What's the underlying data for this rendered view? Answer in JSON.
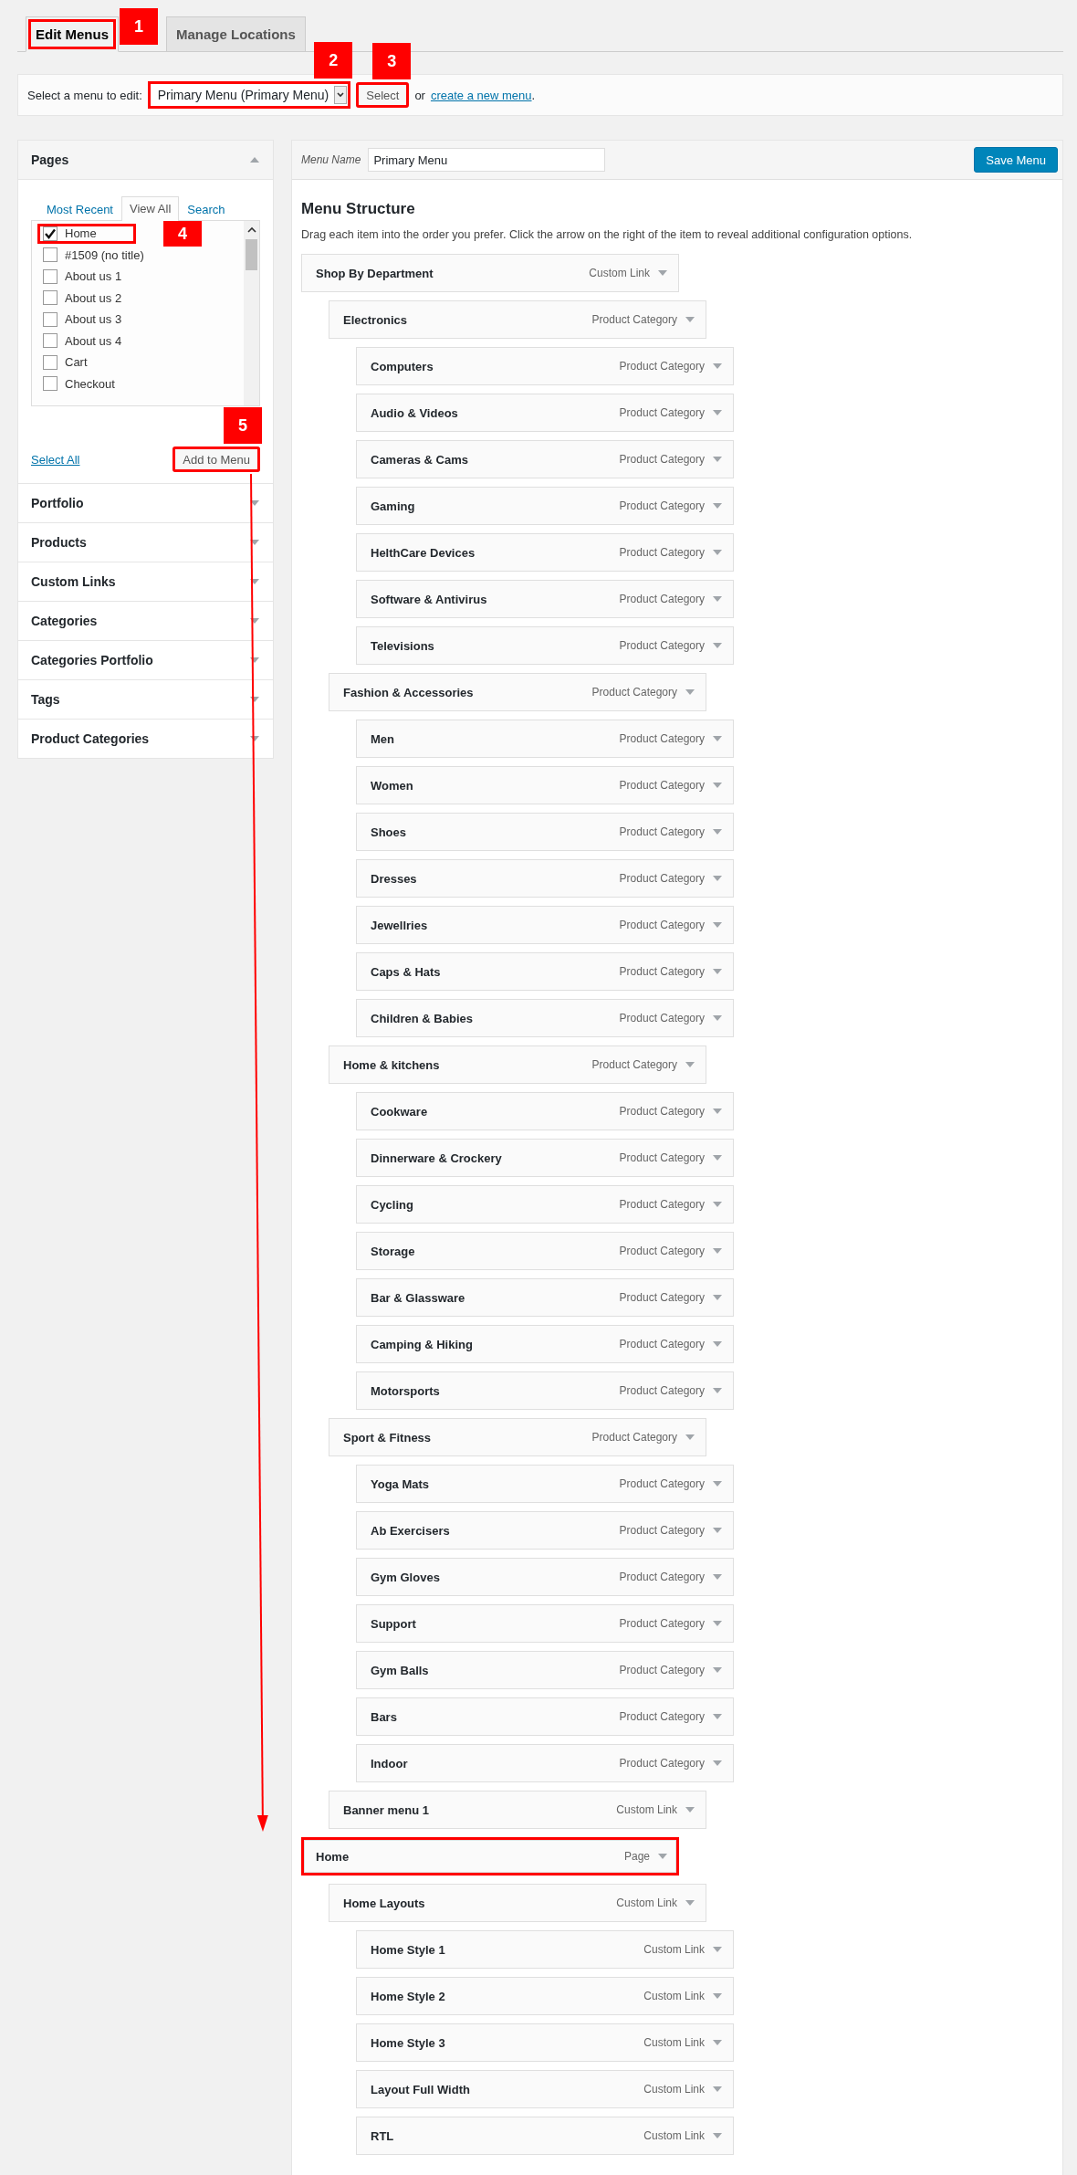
{
  "tabs": [
    {
      "label": "Edit Menus",
      "selected": true,
      "highlighted": true,
      "callout": "1"
    },
    {
      "label": "Manage Locations",
      "selected": false,
      "highlighted": false
    }
  ],
  "menu_select": {
    "label": "Select a menu to edit:",
    "value": "Primary Menu (Primary Menu)",
    "highlighted": true,
    "callout": "2",
    "button": {
      "label": "Select",
      "highlighted": true,
      "callout": "3"
    },
    "or_text": "or",
    "create_link": "create a new menu",
    "period": "."
  },
  "sidebar": {
    "pages": {
      "title": "Pages",
      "expanded": true,
      "tabs": [
        {
          "label": "Most Recent",
          "selected": false
        },
        {
          "label": "View All",
          "selected": true
        },
        {
          "label": "Search",
          "selected": false
        }
      ],
      "items": [
        {
          "label": "Home",
          "checked": true,
          "highlighted": true,
          "callout": "4"
        },
        {
          "label": "#1509 (no title)",
          "checked": false,
          "highlighted": false
        },
        {
          "label": "About us 1",
          "checked": false,
          "highlighted": false
        },
        {
          "label": "About us 2",
          "checked": false,
          "highlighted": false
        },
        {
          "label": "About us 3",
          "checked": false,
          "highlighted": false
        },
        {
          "label": "About us 4",
          "checked": false,
          "highlighted": false
        },
        {
          "label": "Cart",
          "checked": false,
          "highlighted": false
        },
        {
          "label": "Checkout",
          "checked": false,
          "highlighted": false
        }
      ],
      "select_all": "Select All",
      "add_button": {
        "label": "Add to Menu",
        "highlighted": true,
        "callout": "5"
      }
    },
    "sections": [
      {
        "title": "Portfolio",
        "expanded": false
      },
      {
        "title": "Products",
        "expanded": false
      },
      {
        "title": "Custom Links",
        "expanded": false
      },
      {
        "title": "Categories",
        "expanded": false
      },
      {
        "title": "Categories Portfolio",
        "expanded": false
      },
      {
        "title": "Tags",
        "expanded": false
      },
      {
        "title": "Product Categories",
        "expanded": false
      }
    ]
  },
  "editor": {
    "name_label": "Menu Name",
    "name_value": "Primary Menu",
    "save_button": "Save Menu",
    "heading": "Menu Structure",
    "description": "Drag each item into the order you prefer. Click the arrow on the right of the item to reveal additional configuration options.",
    "items": [
      {
        "title": "Shop By Department",
        "type": "Custom Link",
        "highlighted": false,
        "children": [
          {
            "title": "Electronics",
            "type": "Product Category",
            "highlighted": false,
            "children": [
              {
                "title": "Computers",
                "type": "Product Category",
                "highlighted": false
              },
              {
                "title": "Audio & Videos",
                "type": "Product Category",
                "highlighted": false
              },
              {
                "title": "Cameras & Cams",
                "type": "Product Category",
                "highlighted": false
              },
              {
                "title": "Gaming",
                "type": "Product Category",
                "highlighted": false
              },
              {
                "title": "HelthCare Devices",
                "type": "Product Category",
                "highlighted": false
              },
              {
                "title": "Software & Antivirus",
                "type": "Product Category",
                "highlighted": false
              },
              {
                "title": "Televisions",
                "type": "Product Category",
                "highlighted": false
              }
            ]
          },
          {
            "title": "Fashion & Accessories",
            "type": "Product Category",
            "highlighted": false,
            "children": [
              {
                "title": "Men",
                "type": "Product Category",
                "highlighted": false
              },
              {
                "title": "Women",
                "type": "Product Category",
                "highlighted": false
              },
              {
                "title": "Shoes",
                "type": "Product Category",
                "highlighted": false
              },
              {
                "title": "Dresses",
                "type": "Product Category",
                "highlighted": false
              },
              {
                "title": "Jewellries",
                "type": "Product Category",
                "highlighted": false
              },
              {
                "title": "Caps & Hats",
                "type": "Product Category",
                "highlighted": false
              },
              {
                "title": "Children & Babies",
                "type": "Product Category",
                "highlighted": false
              }
            ]
          },
          {
            "title": "Home & kitchens",
            "type": "Product Category",
            "highlighted": false,
            "children": [
              {
                "title": "Cookware",
                "type": "Product Category",
                "highlighted": false
              },
              {
                "title": "Dinnerware & Crockery",
                "type": "Product Category",
                "highlighted": false
              },
              {
                "title": "Cycling",
                "type": "Product Category",
                "highlighted": false
              },
              {
                "title": "Storage",
                "type": "Product Category",
                "highlighted": false
              },
              {
                "title": "Bar & Glassware",
                "type": "Product Category",
                "highlighted": false
              },
              {
                "title": "Camping & Hiking",
                "type": "Product Category",
                "highlighted": false
              },
              {
                "title": "Motorsports",
                "type": "Product Category",
                "highlighted": false
              }
            ]
          },
          {
            "title": "Sport & Fitness",
            "type": "Product Category",
            "highlighted": false,
            "children": [
              {
                "title": "Yoga Mats",
                "type": "Product Category",
                "highlighted": false
              },
              {
                "title": "Ab Exercisers",
                "type": "Product Category",
                "highlighted": false
              },
              {
                "title": "Gym Gloves",
                "type": "Product Category",
                "highlighted": false
              },
              {
                "title": "Support",
                "type": "Product Category",
                "highlighted": false
              },
              {
                "title": "Gym Balls",
                "type": "Product Category",
                "highlighted": false
              },
              {
                "title": "Bars",
                "type": "Product Category",
                "highlighted": false
              },
              {
                "title": "Indoor",
                "type": "Product Category",
                "highlighted": false
              }
            ]
          },
          {
            "title": "Banner menu 1",
            "type": "Custom Link",
            "highlighted": false
          }
        ]
      },
      {
        "title": "Home",
        "type": "Page",
        "highlighted": true,
        "children": [
          {
            "title": "Home Layouts",
            "type": "Custom Link",
            "highlighted": false,
            "children": [
              {
                "title": "Home Style 1",
                "type": "Custom Link",
                "highlighted": false
              },
              {
                "title": "Home Style 2",
                "type": "Custom Link",
                "highlighted": false
              },
              {
                "title": "Home Style 3",
                "type": "Custom Link",
                "highlighted": false
              },
              {
                "title": "Layout Full Width",
                "type": "Custom Link",
                "highlighted": false
              },
              {
                "title": "RTL",
                "type": "Custom Link",
                "highlighted": false
              }
            ]
          }
        ]
      }
    ]
  }
}
